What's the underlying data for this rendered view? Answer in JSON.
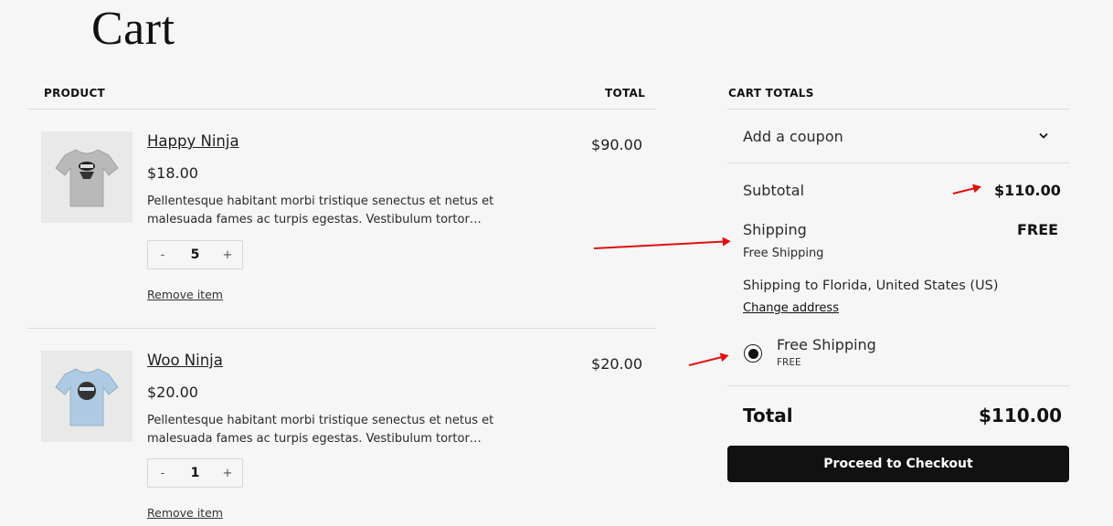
{
  "page": {
    "title": "Cart"
  },
  "table": {
    "product_header": "PRODUCT",
    "total_header": "TOTAL"
  },
  "items": [
    {
      "name": "Happy Ninja",
      "price": "$18.00",
      "description": "Pellentesque habitant morbi tristique senectus et netus et malesuada fames ac turpis egestas. Vestibulum tortor…",
      "quantity": "5",
      "minus": "-",
      "plus": "+",
      "remove": "Remove item",
      "line_total": "$90.00",
      "shirt_color": "#b9b9b9",
      "image_icon": "tshirt-icon"
    },
    {
      "name": "Woo Ninja",
      "price": "$20.00",
      "description": "Pellentesque habitant morbi tristique senectus et netus et malesuada fames ac turpis egestas. Vestibulum tortor…",
      "quantity": "1",
      "minus": "-",
      "plus": "+",
      "remove": "Remove item",
      "line_total": "$20.00",
      "shirt_color": "#aecbe3",
      "image_icon": "tshirt-icon"
    }
  ],
  "totals": {
    "header": "CART TOTALS",
    "coupon": "Add a coupon",
    "coupon_icon": "chevron-down-icon",
    "subtotal_label": "Subtotal",
    "subtotal_value": "$110.00",
    "shipping_label": "Shipping",
    "shipping_value": "FREE",
    "shipping_method": "Free Shipping",
    "shipping_to": "Shipping to Florida, United States (US)",
    "change_address": "Change address",
    "option_label": "Free Shipping",
    "option_price": "FREE",
    "total_label": "Total",
    "total_value": "$110.00",
    "checkout": "Proceed to Checkout"
  },
  "colors": {
    "annotation_arrow": "#e01010",
    "button_bg": "#111111"
  }
}
